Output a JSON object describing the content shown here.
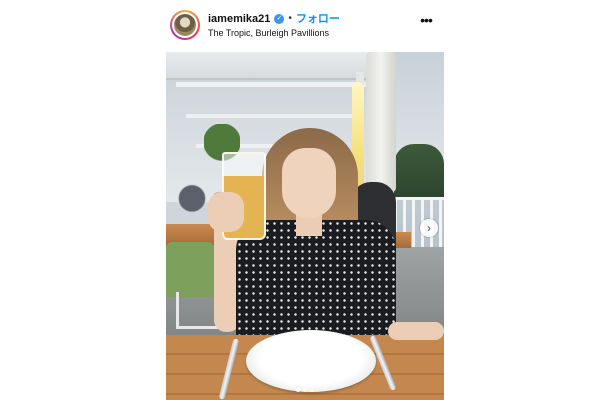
{
  "post": {
    "username": "iamemika21",
    "separator": "•",
    "follow_label": "フォロー",
    "location": "The Tropic, Burleigh Pavillions",
    "pager": {
      "total": 3,
      "active_index": 0
    }
  },
  "icons": {
    "verified": "verified-badge-icon",
    "more": "more-options-icon",
    "next": "chevron-right-icon"
  },
  "colors": {
    "follow": "#0095f6",
    "verified": "#3797f0"
  }
}
